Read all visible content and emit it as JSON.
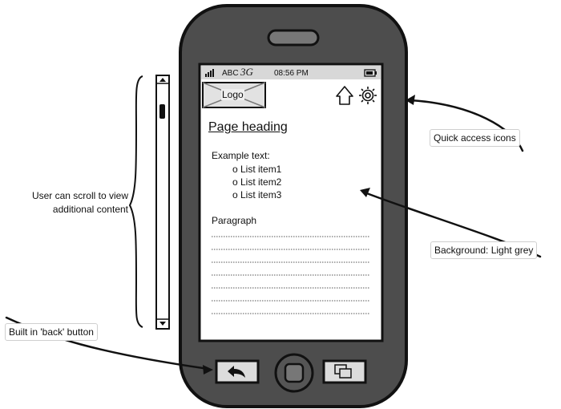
{
  "phone": {
    "status_bar": {
      "carrier": "ABC",
      "network": "3G",
      "time": "08:56 PM"
    },
    "logo_label": "Logo",
    "page_heading": "Page heading",
    "example_text_label": "Example text:",
    "list_items": [
      "o List item1",
      "o List item2",
      "o List item3"
    ],
    "paragraph_label": "Paragraph",
    "home_icon": "home-icon",
    "settings_icon": "gear-icon",
    "back_icon": "back-arrow-icon",
    "window_icon": "windows-icon",
    "screen_color": "#ffffff",
    "body_color": "#4a4a4a"
  },
  "annotations": {
    "scroll_note": "User can scroll to view additional content",
    "quick_access": "Quick access icons",
    "background": "Background: Light grey",
    "back_button": "Built in 'back' button"
  }
}
